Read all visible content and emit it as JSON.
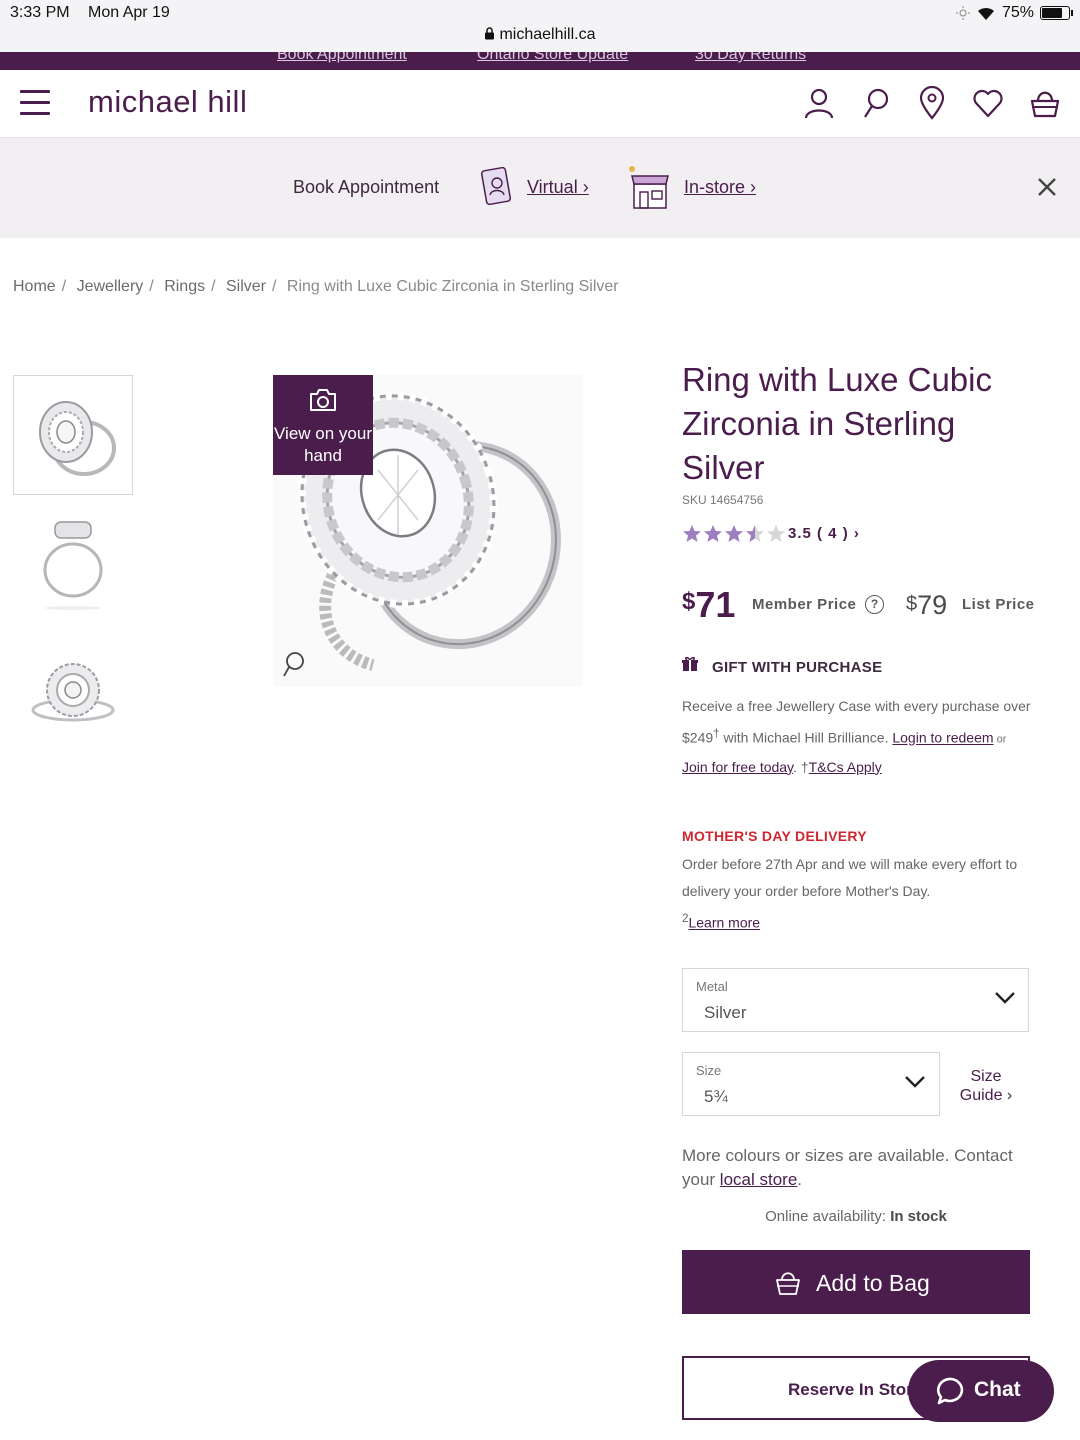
{
  "status_bar": {
    "time": "3:33 PM",
    "date": "Mon Apr 19",
    "battery": "75%",
    "url": "michaelhill.ca"
  },
  "promo_links": [
    "Book Appointment",
    "Ontario Store Update",
    "30 Day Returns"
  ],
  "header": {
    "logo": "michael hill",
    "icons": [
      "account-icon",
      "search-icon",
      "store-locator-icon",
      "wishlist-icon",
      "bag-icon"
    ]
  },
  "appointment": {
    "label": "Book Appointment",
    "virtual": "Virtual ›",
    "instore": "In-store ›"
  },
  "breadcrumb": [
    "Home",
    "Jewellery",
    "Rings",
    "Silver",
    "Ring with Luxe Cubic Zirconia in Sterling Silver"
  ],
  "gallery": {
    "view_on_hand": "View on your hand",
    "thumbnail_count": 3
  },
  "product": {
    "title": "Ring with Luxe Cubic Zirconia in Sterling Silver",
    "sku": "SKU 14654756",
    "rating": 3.5,
    "rating_text": "3.5 ( 4 ) ›",
    "member_price_currency": "$",
    "member_price": "71",
    "member_price_label": "Member Price",
    "list_price_currency": "$",
    "list_price": "79",
    "list_price_label": "List Price"
  },
  "gift": {
    "title": "GIFT WITH PURCHASE",
    "text_1": "Receive a free Jewellery Case with every purchase over $249",
    "sup": "†",
    "text_2": " with Michael Hill Brilliance.",
    "login": "Login to redeem",
    "or": " or ",
    "join": "Join for free today",
    "tcs_prefix": ". †",
    "tcs": "T&Cs Apply"
  },
  "mothers_day": {
    "title": "MOTHER'S DAY DELIVERY",
    "text": "Order before 27th Apr and we will make every effort to delivery your order before Mother's Day.",
    "sup": "2",
    "link": "Learn more"
  },
  "options": {
    "metal_label": "Metal",
    "metal_value": "Silver",
    "size_label": "Size",
    "size_value": "5¾",
    "size_guide": "Size Guide ›"
  },
  "more_info": {
    "text_1": "More colours or sizes are available. Contact your ",
    "link": "local store",
    "text_2": "."
  },
  "availability": {
    "label": "Online availability: ",
    "value": "In stock"
  },
  "actions": {
    "add_to_bag": "Add to Bag",
    "reserve": "Reserve In Store",
    "chat": "Chat"
  },
  "colors": {
    "brand": "#4a1d4c",
    "alert": "#d0262f"
  }
}
